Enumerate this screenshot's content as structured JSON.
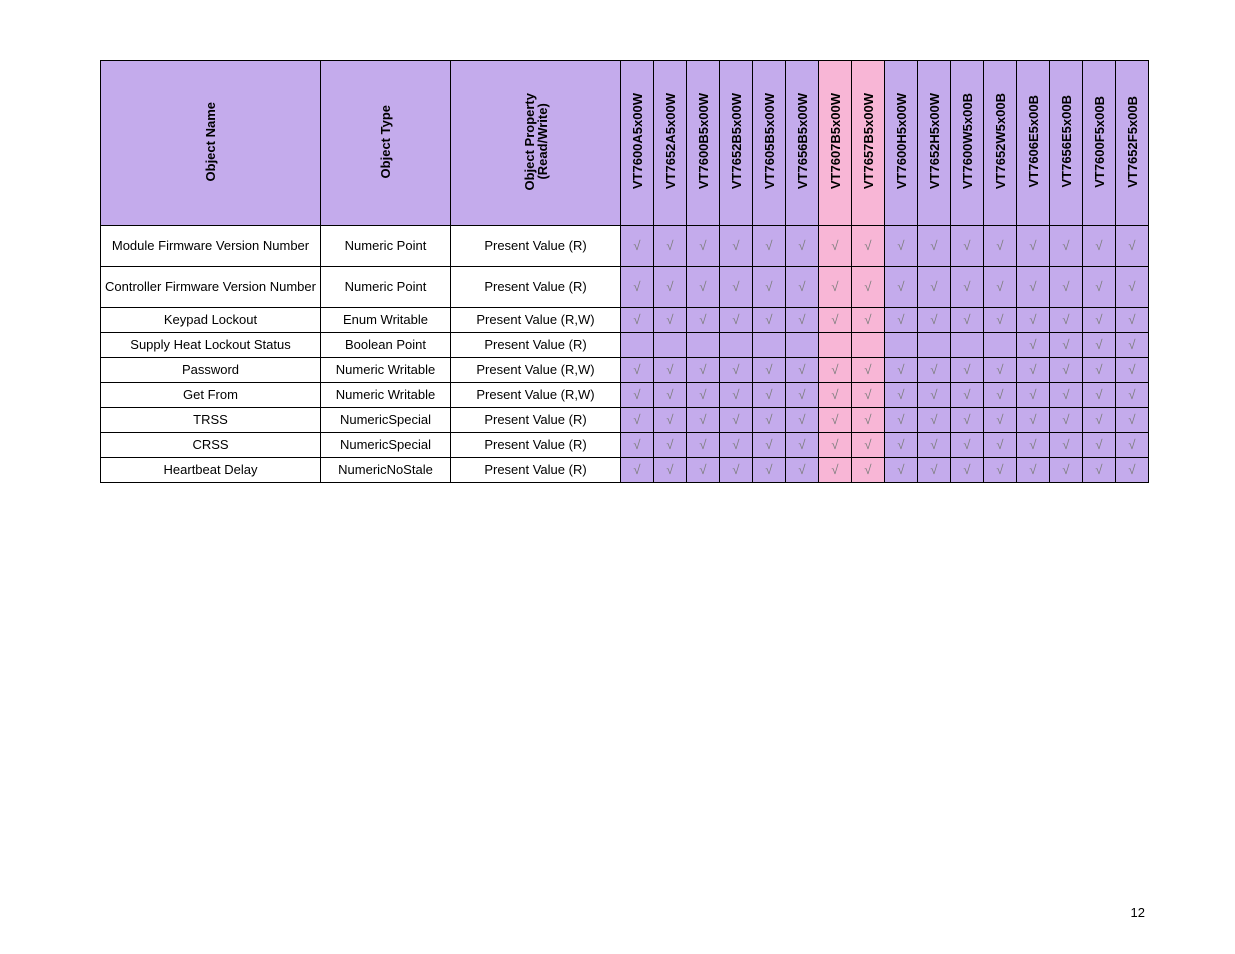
{
  "page_number": "12",
  "headers": {
    "name": "Object Name",
    "type": "Object Type",
    "prop": "Object Property\n(Read/Write)"
  },
  "models": [
    {
      "id": "VT7600A5x00W",
      "pink": false
    },
    {
      "id": "VT7652A5x00W",
      "pink": false
    },
    {
      "id": "VT7600B5x00W",
      "pink": false
    },
    {
      "id": "VT7652B5x00W",
      "pink": false
    },
    {
      "id": "VT7605B5x00W",
      "pink": false
    },
    {
      "id": "VT7656B5x00W",
      "pink": false
    },
    {
      "id": "VT7607B5x00W",
      "pink": true
    },
    {
      "id": "VT7657B5x00W",
      "pink": true
    },
    {
      "id": "VT7600H5x00W",
      "pink": false
    },
    {
      "id": "VT7652H5x00W",
      "pink": false
    },
    {
      "id": "VT7600W5x00B",
      "pink": false
    },
    {
      "id": "VT7652W5x00B",
      "pink": false
    },
    {
      "id": "VT7606E5x00B",
      "pink": false
    },
    {
      "id": "VT7656E5x00B",
      "pink": false
    },
    {
      "id": "VT7600F5x00B",
      "pink": false
    },
    {
      "id": "VT7652F5x00B",
      "pink": false
    }
  ],
  "rows": [
    {
      "name": "Module Firmware Version Number",
      "type": "Numeric Point",
      "prop": "Present Value (R)",
      "two_line": true,
      "checks": [
        true,
        true,
        true,
        true,
        true,
        true,
        true,
        true,
        true,
        true,
        true,
        true,
        true,
        true,
        true,
        true
      ]
    },
    {
      "name": "Controller Firmware Version Number",
      "type": "Numeric Point",
      "prop": "Present Value (R)",
      "two_line": true,
      "checks": [
        true,
        true,
        true,
        true,
        true,
        true,
        true,
        true,
        true,
        true,
        true,
        true,
        true,
        true,
        true,
        true
      ]
    },
    {
      "name": "Keypad Lockout",
      "type": "Enum Writable",
      "prop": "Present Value (R,W)",
      "two_line": false,
      "checks": [
        true,
        true,
        true,
        true,
        true,
        true,
        true,
        true,
        true,
        true,
        true,
        true,
        true,
        true,
        true,
        true
      ]
    },
    {
      "name": "Supply Heat Lockout Status",
      "type": "Boolean Point",
      "prop": "Present Value (R)",
      "two_line": false,
      "checks": [
        false,
        false,
        false,
        false,
        false,
        false,
        false,
        false,
        false,
        false,
        false,
        false,
        true,
        true,
        true,
        true
      ]
    },
    {
      "name": "Password",
      "type": "Numeric Writable",
      "prop": "Present Value (R,W)",
      "two_line": false,
      "checks": [
        true,
        true,
        true,
        true,
        true,
        true,
        true,
        true,
        true,
        true,
        true,
        true,
        true,
        true,
        true,
        true
      ]
    },
    {
      "name": "Get From",
      "type": "Numeric Writable",
      "prop": "Present Value (R,W)",
      "two_line": false,
      "checks": [
        true,
        true,
        true,
        true,
        true,
        true,
        true,
        true,
        true,
        true,
        true,
        true,
        true,
        true,
        true,
        true
      ]
    },
    {
      "name": "TRSS",
      "type": "NumericSpecial",
      "prop": "Present Value (R)",
      "two_line": false,
      "checks": [
        true,
        true,
        true,
        true,
        true,
        true,
        true,
        true,
        true,
        true,
        true,
        true,
        true,
        true,
        true,
        true
      ]
    },
    {
      "name": "CRSS",
      "type": "NumericSpecial",
      "prop": "Present Value (R)",
      "two_line": false,
      "checks": [
        true,
        true,
        true,
        true,
        true,
        true,
        true,
        true,
        true,
        true,
        true,
        true,
        true,
        true,
        true,
        true
      ]
    },
    {
      "name": "Heartbeat Delay",
      "type": "NumericNoStale",
      "prop": "Present Value (R)",
      "two_line": false,
      "checks": [
        true,
        true,
        true,
        true,
        true,
        true,
        true,
        true,
        true,
        true,
        true,
        true,
        true,
        true,
        true,
        true
      ]
    }
  ]
}
